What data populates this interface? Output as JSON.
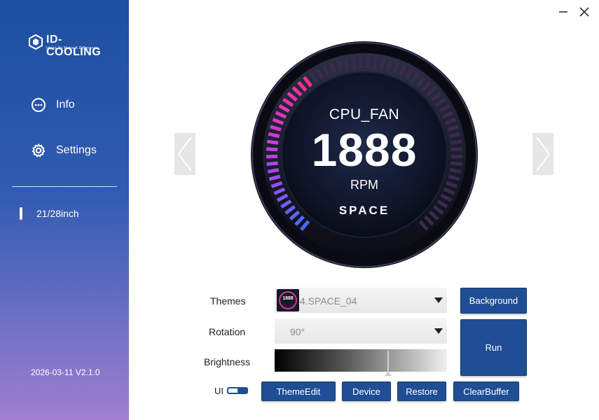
{
  "app": {
    "brand": "ID-COOLING",
    "tagline": "Ideas To Make A Difference",
    "version": "2026-03-11 V2.1.0"
  },
  "sidebar": {
    "items": [
      {
        "label": "Info",
        "icon": "info-dots-icon"
      },
      {
        "label": "Settings",
        "icon": "gear-icon"
      }
    ],
    "device_size": "21/28inch"
  },
  "gauge": {
    "sensor": "CPU_FAN",
    "value": "1888",
    "unit": "RPM",
    "theme_name": "SPACE",
    "level_fraction": 0.38,
    "accent_colors": [
      "#4a6bff",
      "#c23de0",
      "#ff2d8a"
    ]
  },
  "controls": {
    "themes_label": "Themes",
    "themes_value": "4.SPACE_04",
    "themes_thumb_value": "1888",
    "rotation_label": "Rotation",
    "rotation_value": "90°",
    "brightness_label": "Brightness",
    "brightness_fraction": 0.66,
    "ui_label": "UI"
  },
  "buttons": {
    "background": "Background",
    "run": "Run",
    "theme_edit": "ThemeEdit",
    "device": "Device",
    "restore": "Restore",
    "clear_buffer": "ClearBuffer"
  },
  "colors": {
    "button_blue": "#1f4e94",
    "sidebar_top": "#1d4fa0",
    "sidebar_bottom": "#a17fd0"
  }
}
